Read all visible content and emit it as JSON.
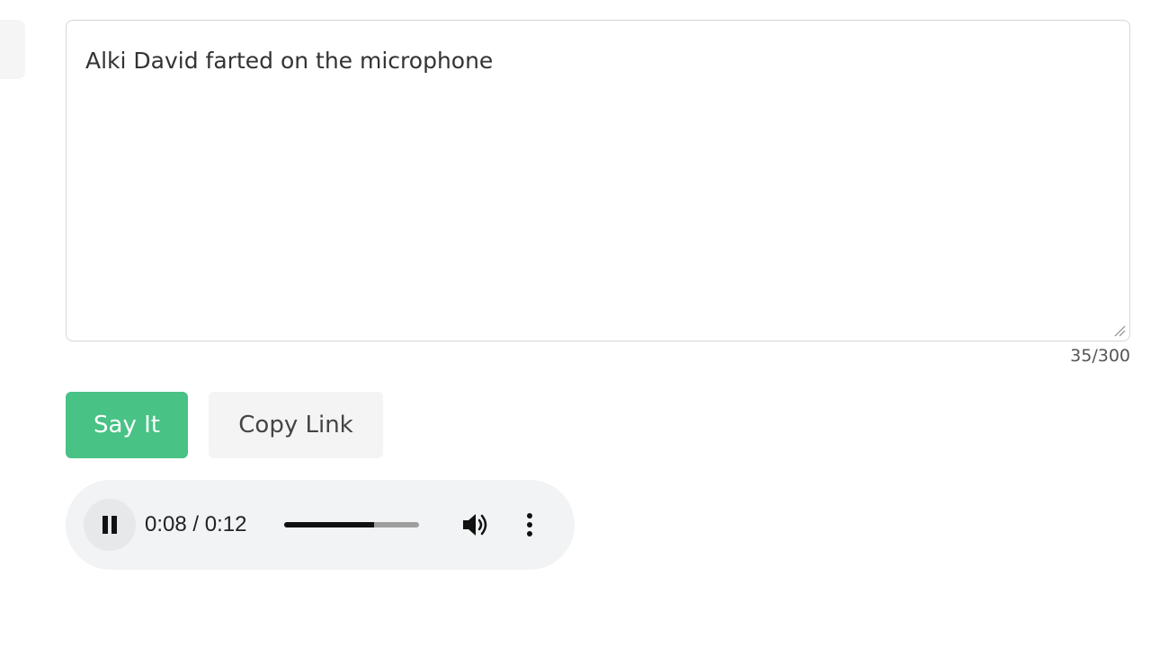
{
  "message_input": {
    "value": "Alki David farted on the microphone",
    "counter": "35/300"
  },
  "buttons": {
    "say_it": "Say It",
    "copy_link": "Copy Link"
  },
  "audio_player": {
    "time": "0:08 / 0:12",
    "progress_fraction": 0.667,
    "state": "playing",
    "icons": {
      "play_pause": "pause-icon",
      "volume": "volume-icon",
      "more": "more-vertical-icon"
    }
  },
  "colors": {
    "say_it_bg": "#48c285",
    "copy_link_bg": "#f4f4f4",
    "player_bg": "#f1f3f4"
  }
}
